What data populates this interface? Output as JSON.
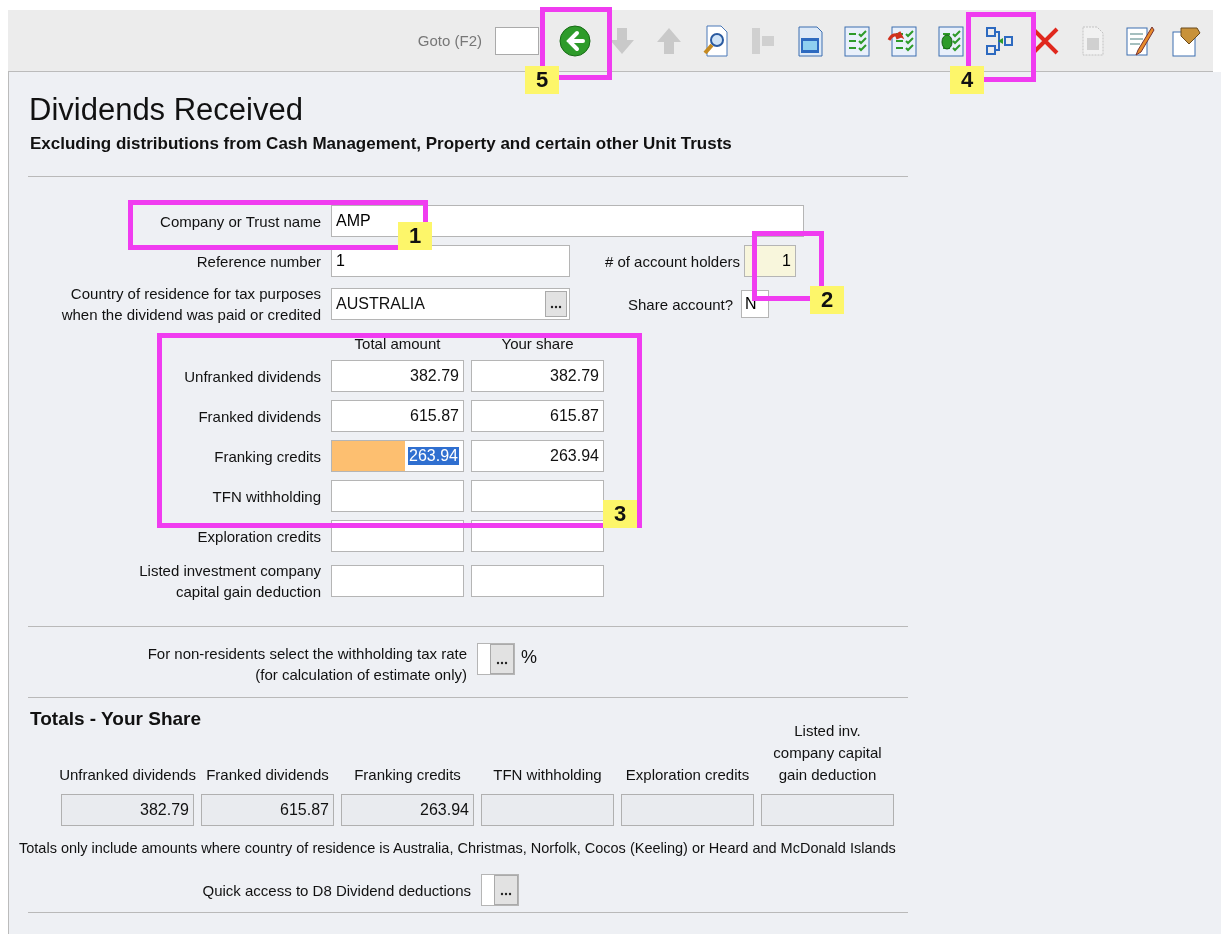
{
  "toolbar": {
    "goto_label": "Goto (F2)",
    "icons": [
      {
        "kind": "back",
        "disabled": false
      },
      {
        "kind": "down",
        "disabled": true
      },
      {
        "kind": "up",
        "disabled": true
      },
      {
        "kind": "preview",
        "disabled": false
      },
      {
        "kind": "jump",
        "disabled": true
      },
      {
        "kind": "calculator",
        "disabled": false
      },
      {
        "kind": "checklist",
        "disabled": false
      },
      {
        "kind": "checklist-undo",
        "disabled": false
      },
      {
        "kind": "checklist-bug",
        "disabled": false
      },
      {
        "kind": "split",
        "disabled": false
      },
      {
        "kind": "delete",
        "disabled": false
      },
      {
        "kind": "copy",
        "disabled": true
      },
      {
        "kind": "edit",
        "disabled": false
      },
      {
        "kind": "paste",
        "disabled": false
      }
    ]
  },
  "title": "Dividends Received",
  "subtitle": "Excluding distributions from Cash Management, Property and certain other Unit Trusts",
  "company": {
    "label": "Company or Trust name",
    "value": "AMP"
  },
  "reference": {
    "label": "Reference number",
    "value": "1"
  },
  "account_holders": {
    "label": "# of account holders",
    "value": "1"
  },
  "country": {
    "label_lines": [
      "Country of residence for tax purposes",
      "when the dividend was paid or credited"
    ],
    "value": "AUSTRALIA"
  },
  "share_account": {
    "label": "Share account?",
    "value": "N"
  },
  "amounts": {
    "columns": [
      "Total amount",
      "Your share"
    ],
    "rows": [
      {
        "label_lines": [
          "Unfranked dividends"
        ],
        "total": "382.79",
        "share": "382.79",
        "highlighted": false
      },
      {
        "label_lines": [
          "Franked dividends"
        ],
        "total": "615.87",
        "share": "615.87",
        "highlighted": false
      },
      {
        "label_lines": [
          "Franking credits"
        ],
        "total": "263.94",
        "share": "263.94",
        "highlighted": true
      },
      {
        "label_lines": [
          "TFN withholding"
        ],
        "highlighted": false
      },
      {
        "label_lines": [
          "Exploration credits"
        ],
        "highlighted": false
      },
      {
        "label_lines": [
          "Listed investment company",
          "capital gain deduction"
        ],
        "highlighted": false
      }
    ]
  },
  "withholding": {
    "label_lines": [
      "For non-residents select the withholding tax rate",
      "(for calculation of estimate only)"
    ],
    "unit": "%"
  },
  "totals": {
    "heading": "Totals - Your Share",
    "columns": [
      {
        "header_lines": [
          "Unfranked dividends"
        ],
        "value": "382.79"
      },
      {
        "header_lines": [
          "Franked dividends"
        ],
        "value": "615.87"
      },
      {
        "header_lines": [
          "Franking credits"
        ],
        "value": "263.94"
      },
      {
        "header_lines": [
          "TFN withholding"
        ]
      },
      {
        "header_lines": [
          "Exploration credits"
        ]
      },
      {
        "header_lines": [
          "Listed inv.",
          "company capital",
          "gain deduction"
        ]
      }
    ],
    "note": "Totals only include amounts where country of residence is Australia, Christmas, Norfolk, Cocos (Keeling) or Heard and McDonald Islands"
  },
  "quick_access": {
    "label": "Quick access to D8 Dividend deductions"
  },
  "annotations": [
    {
      "number": "1"
    },
    {
      "number": "2"
    },
    {
      "number": "3"
    },
    {
      "number": "4"
    },
    {
      "number": "5"
    }
  ]
}
